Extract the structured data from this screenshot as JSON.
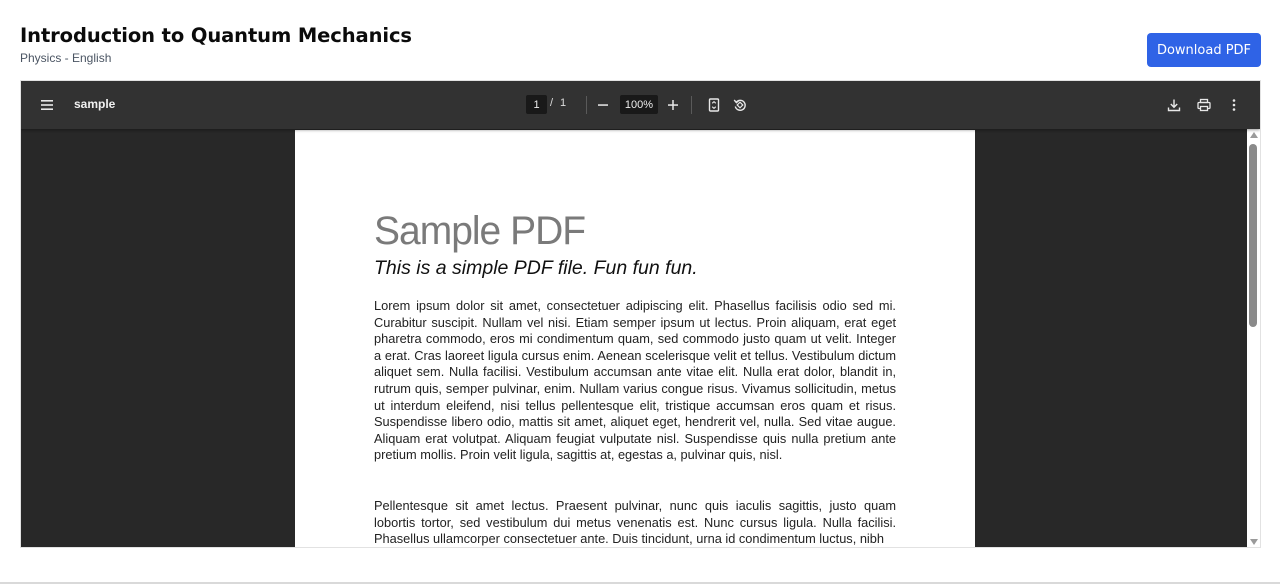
{
  "header": {
    "title": "Introduction to Quantum Mechanics",
    "subtitle": "Physics - English",
    "download_label": "Download PDF"
  },
  "viewer": {
    "document_name": "sample",
    "current_page": "1",
    "page_separator": "/",
    "total_pages": "1",
    "zoom": "100%",
    "icons": {
      "menu": "hamburger-menu-icon",
      "zoom_out": "minus-icon",
      "zoom_in": "plus-icon",
      "fit": "fit-page-icon",
      "rotate": "rotate-icon",
      "download": "download-icon",
      "print": "print-icon",
      "more": "more-vert-icon"
    }
  },
  "pdf": {
    "title": "Sample PDF",
    "subtitle": "This is a simple PDF file. Fun fun fun.",
    "paragraph1": "Lorem ipsum dolor sit amet, consectetuer adipiscing elit. Phasellus facilisis odio sed mi. Curabitur suscipit. Nullam vel nisi. Etiam semper ipsum ut lectus. Proin aliquam, erat eget pharetra commodo, eros mi condimentum quam, sed commodo justo quam ut velit. Integer a erat. Cras laoreet ligula cursus enim. Aenean scelerisque velit et tellus. Vestibulum dictum aliquet sem. Nulla facilisi. Vestibulum accumsan ante vitae elit. Nulla erat dolor, blandit in, rutrum quis, semper pulvinar, enim. Nullam varius congue risus. Vivamus sollicitudin, metus ut interdum eleifend, nisi tellus pellentesque elit, tristique accumsan eros quam et risus. Suspendisse libero odio, mattis sit amet, aliquet eget, hendrerit vel, nulla. Sed vitae augue. Aliquam erat volutpat. Aliquam feugiat vulputate nisl. Suspendisse quis nulla pretium ante pretium mollis. Proin velit ligula, sagittis at, egestas a, pulvinar quis, nisl.",
    "paragraph2": "Pellentesque sit amet lectus. Praesent pulvinar, nunc quis iaculis sagittis, justo quam lobortis tortor, sed vestibulum dui metus venenatis est. Nunc cursus ligula. Nulla facilisi. Phasellus ullamcorper consectetuer ante. Duis tincidunt, urna id condimentum luctus, nibh"
  },
  "colors": {
    "accent": "#2f63e6",
    "toolbar": "#323232",
    "viewer_bg": "#282828"
  }
}
